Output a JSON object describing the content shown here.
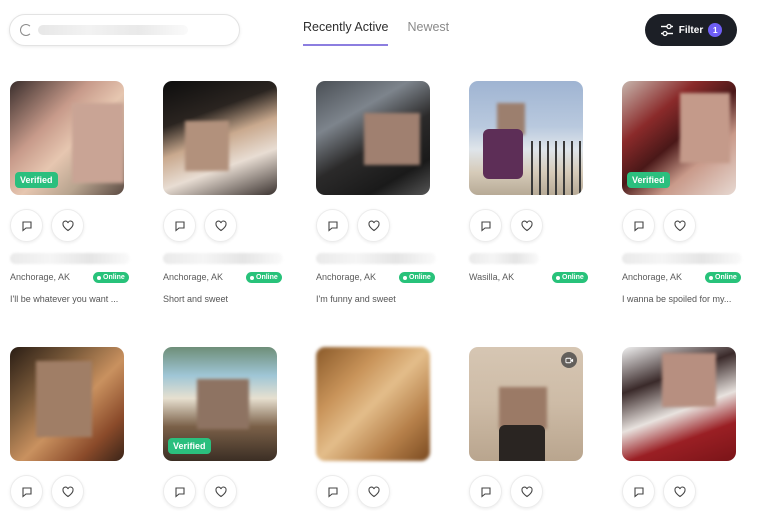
{
  "search": {
    "placeholder": ""
  },
  "tabs": [
    {
      "label": "Recently Active",
      "active": true
    },
    {
      "label": "Newest",
      "active": false
    }
  ],
  "filter": {
    "label": "Filter",
    "count": "1",
    "icon": "sliders-icon"
  },
  "colors": {
    "accent": "#6f5ef5",
    "verified": "#2bbf7e",
    "online": "#28c27a",
    "dark": "#1c1f26"
  },
  "verified_label": "Verified",
  "online_label": "Online",
  "profiles": [
    {
      "location": "Anchorage, AK",
      "bio": "I'll be whatever you want ...",
      "verified": true,
      "online": true,
      "video": false
    },
    {
      "location": "Anchorage, AK",
      "bio": "Short and sweet",
      "verified": false,
      "online": true,
      "video": false
    },
    {
      "location": "Anchorage, AK",
      "bio": "I'm funny and sweet",
      "verified": false,
      "online": true,
      "video": false
    },
    {
      "location": "Wasilla, AK",
      "bio": "",
      "verified": false,
      "online": true,
      "video": false
    },
    {
      "location": "Anchorage, AK",
      "bio": "I wanna be spoiled for my...",
      "verified": true,
      "online": true,
      "video": false
    },
    {
      "location": "",
      "bio": "",
      "verified": false,
      "online": false,
      "video": false
    },
    {
      "location": "",
      "bio": "",
      "verified": true,
      "online": false,
      "video": false
    },
    {
      "location": "",
      "bio": "",
      "verified": false,
      "online": false,
      "video": false
    },
    {
      "location": "",
      "bio": "",
      "verified": false,
      "online": false,
      "video": true
    },
    {
      "location": "",
      "bio": "",
      "verified": false,
      "online": false,
      "video": false
    }
  ]
}
